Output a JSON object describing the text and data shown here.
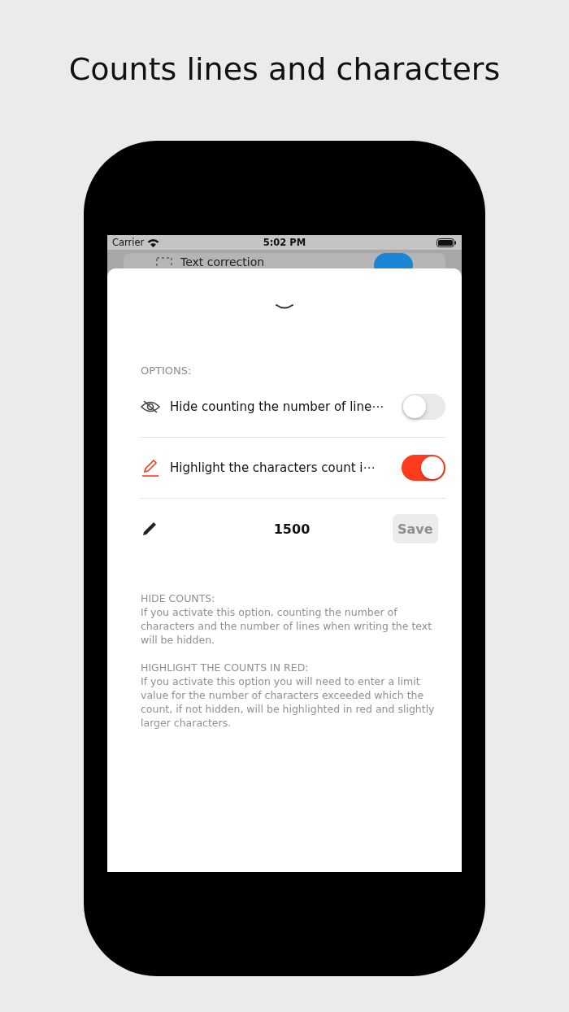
{
  "headline": "Counts lines and characters",
  "status_bar": {
    "carrier": "Carrier",
    "time": "5:02 PM"
  },
  "background_row": {
    "label": "Text correction",
    "on": true
  },
  "sheet": {
    "section_title": "OPTIONS:",
    "rows": [
      {
        "kind": "toggle",
        "label": "Hide counting the number of line⋯",
        "on": false
      },
      {
        "kind": "toggle",
        "label": "Highlight the characters count i⋯",
        "on": true
      },
      {
        "kind": "input",
        "value": "1500",
        "button": "Save",
        "disabled": true
      }
    ],
    "notes": [
      {
        "heading": "HIDE COUNTS:",
        "text": "If you activate this option, counting the number of characters and the number of lines when writing the text will be hidden."
      },
      {
        "heading": "HIGHLIGHT THE COUNTS IN RED:",
        "text": "If you activate this option you will need to enter a limit value for the number of characters exceeded which the count, if not hidden, will be highlighted in red and slightly larger characters."
      }
    ]
  }
}
